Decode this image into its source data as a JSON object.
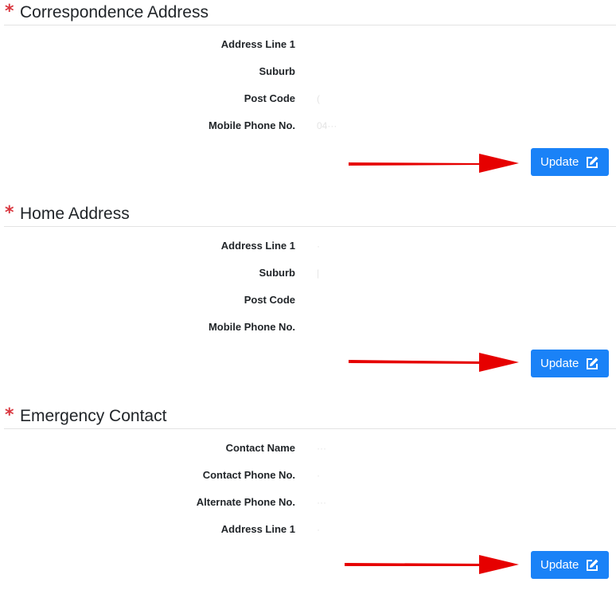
{
  "sections": [
    {
      "title": "Correspondence Address",
      "required_mark": "*",
      "fields": [
        {
          "label": "Address Line 1",
          "value": ""
        },
        {
          "label": "Suburb",
          "value": ""
        },
        {
          "label": "Post Code",
          "value": "("
        },
        {
          "label": "Mobile Phone No.",
          "value": "04···"
        }
      ],
      "update_button": {
        "label": "Update",
        "icon": "edit-icon"
      }
    },
    {
      "title": "Home Address",
      "required_mark": "*",
      "fields": [
        {
          "label": "Address Line 1",
          "value": "·"
        },
        {
          "label": "Suburb",
          "value": "|"
        },
        {
          "label": "Post Code",
          "value": ""
        },
        {
          "label": "Mobile Phone No.",
          "value": ""
        }
      ],
      "update_button": {
        "label": "Update",
        "icon": "edit-icon"
      }
    },
    {
      "title": "Emergency Contact",
      "required_mark": "*",
      "fields": [
        {
          "label": "Contact Name",
          "value": "···"
        },
        {
          "label": "Contact Phone No.",
          "value": "·"
        },
        {
          "label": "Alternate Phone No.",
          "value": "···"
        },
        {
          "label": "Address Line 1",
          "value": "·"
        }
      ],
      "update_button": {
        "label": "Update",
        "icon": "edit-icon"
      }
    }
  ],
  "colors": {
    "required_asterisk": "#d9363e",
    "button_bg": "#1a82f7",
    "annotation_arrow": "#e60000"
  }
}
